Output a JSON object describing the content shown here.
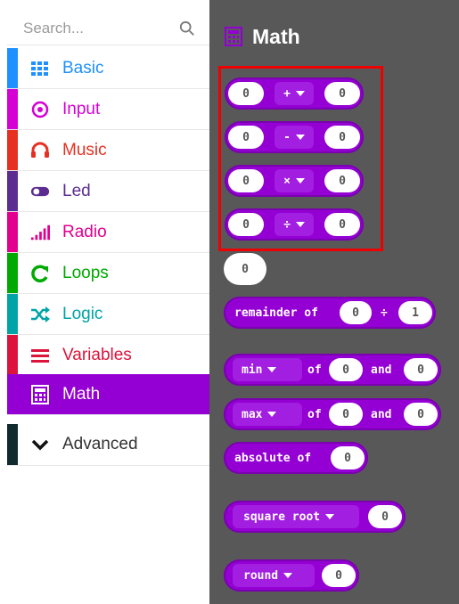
{
  "search": {
    "placeholder": "Search..."
  },
  "categories": [
    {
      "label": "Basic",
      "color": "#1e90ff",
      "icon": "grid-icon"
    },
    {
      "label": "Input",
      "color": "#d400d4",
      "icon": "target-icon"
    },
    {
      "label": "Music",
      "color": "#e63022",
      "icon": "headphones-icon"
    },
    {
      "label": "Led",
      "color": "#5c2d91",
      "icon": "toggle-icon"
    },
    {
      "label": "Radio",
      "color": "#e3008c",
      "icon": "signal-bars-icon"
    },
    {
      "label": "Loops",
      "color": "#00aa00",
      "icon": "refresh-icon"
    },
    {
      "label": "Logic",
      "color": "#00a4a6",
      "icon": "shuffle-icon"
    },
    {
      "label": "Variables",
      "color": "#dc143c",
      "icon": "list-icon"
    },
    {
      "label": "Math",
      "color": "#9400d3",
      "icon": "calculator-icon"
    },
    {
      "label": "Advanced",
      "color": "#102a2e",
      "icon": "chevron-down-icon"
    }
  ],
  "workspace": {
    "title": "Math",
    "arith": [
      {
        "left": "0",
        "op": "+",
        "right": "0"
      },
      {
        "left": "0",
        "op": "-",
        "right": "0"
      },
      {
        "left": "0",
        "op": "×",
        "right": "0"
      },
      {
        "left": "0",
        "op": "÷",
        "right": "0"
      }
    ],
    "number": "0",
    "remainder": {
      "label": "remainder of",
      "a": "0",
      "sep": "÷",
      "b": "1"
    },
    "min": {
      "op": "min",
      "of": "of",
      "a": "0",
      "and": "and",
      "b": "0"
    },
    "max": {
      "op": "max",
      "of": "of",
      "a": "0",
      "and": "and",
      "b": "0"
    },
    "absolute": {
      "label": "absolute of",
      "value": "0"
    },
    "sqrt": {
      "op": "square root",
      "value": "0"
    },
    "round": {
      "op": "round",
      "value": "0"
    }
  }
}
